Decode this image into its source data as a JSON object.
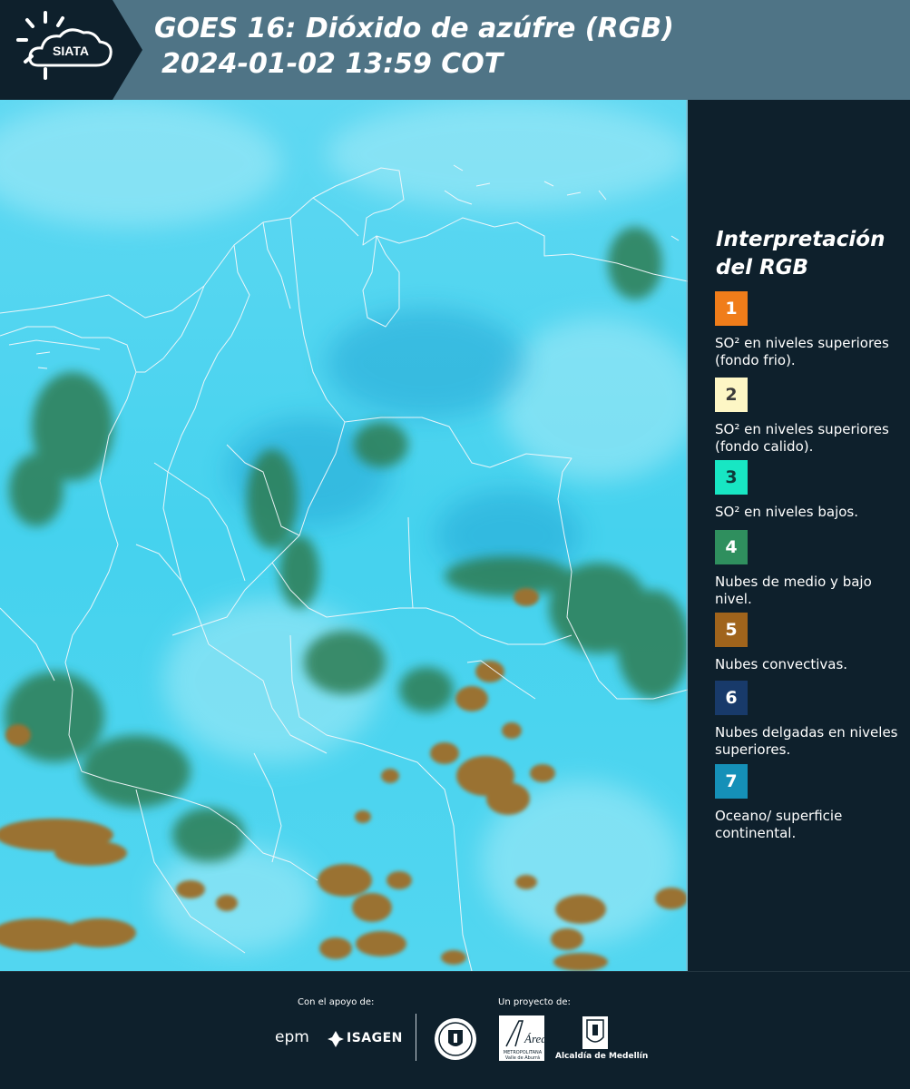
{
  "header": {
    "logo_text": "SIATA",
    "title_line1": "GOES 16: Dióxido de azúfre (RGB)",
    "title_line2": "2024-01-02 13:59 COT"
  },
  "legend": {
    "title_line1": "Interpretación",
    "title_line2": "del RGB",
    "items": [
      {
        "number": "1",
        "text": "SO² en niveles superiores (fondo frio).",
        "color": "#f07d1a",
        "text_color": "#ffffff"
      },
      {
        "number": "2",
        "text": "SO² en niveles superiores (fondo calido).",
        "color": "#fdf6c5",
        "text_color": "#3a3a3a"
      },
      {
        "number": "3",
        "text": "SO² en niveles bajos.",
        "color": "#18e6c3",
        "text_color": "#0e3a3a"
      },
      {
        "number": "4",
        "text": "Nubes de medio y bajo nivel.",
        "color": "#2f8f5e",
        "text_color": "#ffffff"
      },
      {
        "number": "5",
        "text": "Nubes convectivas.",
        "color": "#a0641c",
        "text_color": "#ffffff"
      },
      {
        "number": "6",
        "text": "Nubes delgadas en niveles superiores.",
        "color": "#183a6a",
        "text_color": "#ffffff"
      },
      {
        "number": "7",
        "text": "Oceano/ superficie continental.",
        "color": "#1590b8",
        "text_color": "#ffffff"
      }
    ]
  },
  "footer": {
    "support_label": "Con el apoyo de:",
    "project_label": "Un proyecto de:",
    "sponsor_1": "epm",
    "sponsor_2": "ISAGEN",
    "area_text": "Área",
    "area_sub": "METROPOLITANA Valle de Aburrá",
    "alcaldia": "Alcaldía de Medellín"
  },
  "colors": {
    "header_bg": "#4f7486",
    "panel_bg": "#0e202c",
    "map_cyan": "#33d4ee",
    "cloud_green": "#2e7a4e",
    "cloud_brown": "#9a7230"
  }
}
